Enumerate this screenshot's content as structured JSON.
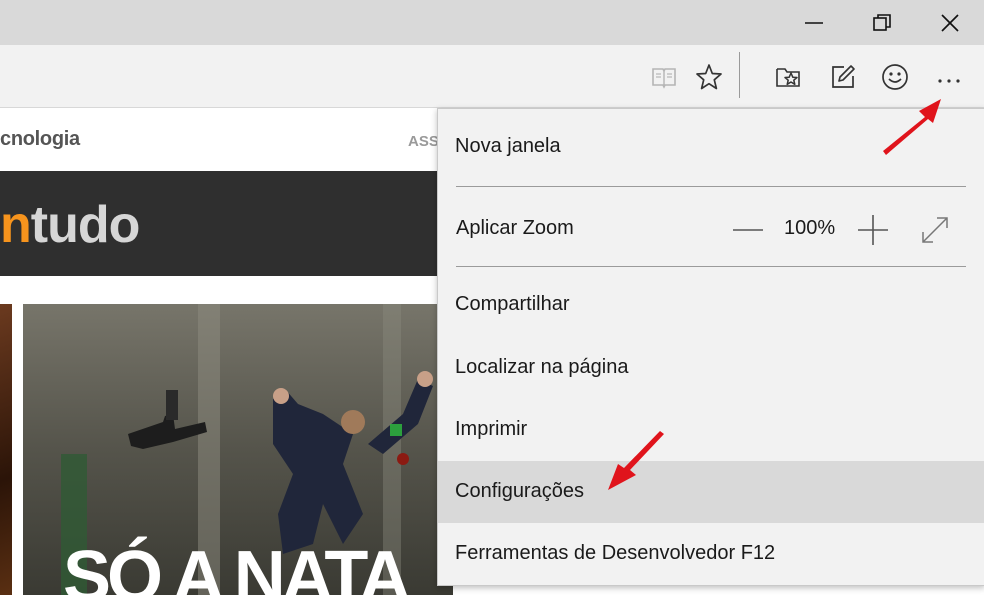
{
  "window": {
    "controls": {
      "minimize_icon": "minimize-icon",
      "restore_icon": "restore-icon",
      "close_icon": "close-icon"
    }
  },
  "toolbar": {
    "icons": [
      "reading-view-icon",
      "favorite-star-icon",
      "hub-icon",
      "web-note-icon",
      "feedback-smiley-icon",
      "more-actions-icon"
    ]
  },
  "page": {
    "nav_text": "cnologia",
    "nav_right_text": "ASS",
    "logo_prefix": "n",
    "logo_rest": "tudo",
    "hero_headline": "SÓ A NATA"
  },
  "menu": {
    "new_window": "Nova janela",
    "zoom_label": "Aplicar Zoom",
    "zoom_value": "100%",
    "share": "Compartilhar",
    "find_on_page": "Localizar na página",
    "print": "Imprimir",
    "settings": "Configurações",
    "dev_tools": "Ferramentas de Desenvolvedor F12"
  },
  "colors": {
    "titlebar": "#d9d9d9",
    "toolbar": "#f2f2f2",
    "menu_bg": "#f2f2f2",
    "menu_highlight": "#d9d9d9",
    "annotation_arrow": "#e0141c",
    "logo_accent": "#f7941d"
  }
}
